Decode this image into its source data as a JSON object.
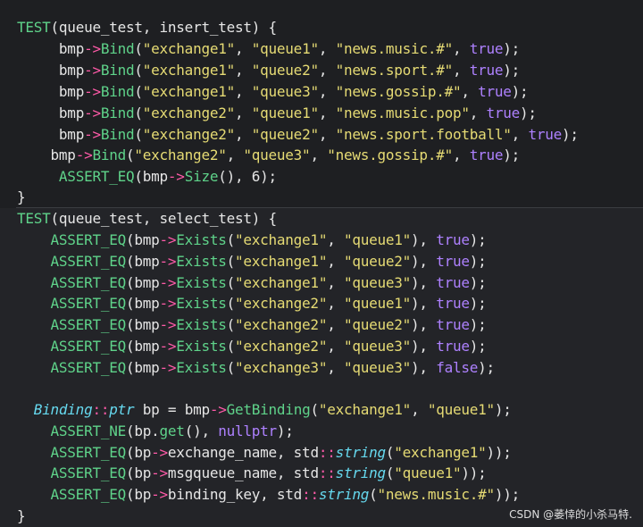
{
  "editor": {
    "lines": [
      {
        "text": "TEST(queue_test, insert_test) {"
      },
      {
        "text": "     bmp->Bind(\"exchange1\", \"queue1\", \"news.music.#\", true);"
      },
      {
        "text": "     bmp->Bind(\"exchange1\", \"queue2\", \"news.sport.#\", true);"
      },
      {
        "text": "     bmp->Bind(\"exchange1\", \"queue3\", \"news.gossip.#\", true);"
      },
      {
        "text": "     bmp->Bind(\"exchange2\", \"queue1\", \"news.music.pop\", true);"
      },
      {
        "text": "     bmp->Bind(\"exchange2\", \"queue2\", \"news.sport.football\", true);"
      },
      {
        "text": "    bmp->Bind(\"exchange2\", \"queue3\", \"news.gossip.#\", true);"
      },
      {
        "text": "     ASSERT_EQ(bmp->Size(), 6);"
      },
      {
        "text": "}"
      },
      {
        "text": "TEST(queue_test, select_test) {"
      },
      {
        "text": "    ASSERT_EQ(bmp->Exists(\"exchange1\", \"queue1\"), true);"
      },
      {
        "text": "    ASSERT_EQ(bmp->Exists(\"exchange1\", \"queue2\"), true);"
      },
      {
        "text": "    ASSERT_EQ(bmp->Exists(\"exchange1\", \"queue3\"), true);"
      },
      {
        "text": "    ASSERT_EQ(bmp->Exists(\"exchange2\", \"queue1\"), true);"
      },
      {
        "text": "    ASSERT_EQ(bmp->Exists(\"exchange2\", \"queue2\"), true);"
      },
      {
        "text": "    ASSERT_EQ(bmp->Exists(\"exchange2\", \"queue3\"), true);"
      },
      {
        "text": "    ASSERT_EQ(bmp->Exists(\"exchange3\", \"queue3\"), false);"
      },
      {
        "text": ""
      },
      {
        "text": "  Binding::ptr bp = bmp->GetBinding(\"exchange1\", \"queue1\");"
      },
      {
        "text": "    ASSERT_NE(bp.get(), nullptr);"
      },
      {
        "text": "    ASSERT_EQ(bp->exchange_name, std::string(\"exchange1\"));"
      },
      {
        "text": "    ASSERT_EQ(bp->msgqueue_name, std::string(\"queue1\"));"
      },
      {
        "text": "    ASSERT_EQ(bp->binding_key, std::string(\"news.music.#\"));"
      },
      {
        "text": "}"
      }
    ]
  },
  "watermark": {
    "text": "CSDN @萎悻的小杀马特."
  },
  "colors": {
    "background": "#1e1f22",
    "function": "#5fd38a",
    "arrow_operator": "#ff5aa8",
    "string": "#e6db74",
    "boolean": "#ae81ff",
    "type": "#66d9ef",
    "text": "#e6e6e6"
  }
}
